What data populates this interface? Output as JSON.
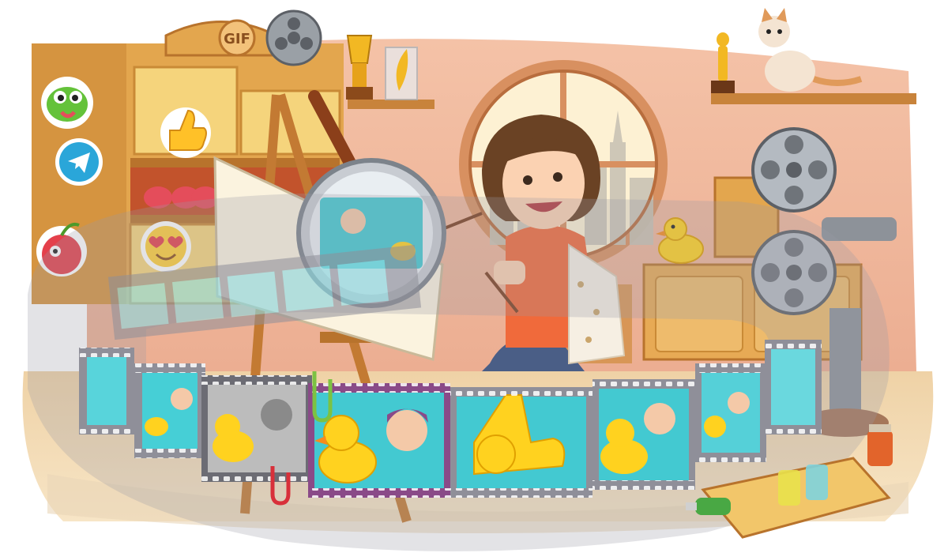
{
  "scene": {
    "cabinet_sign": "GIF",
    "palette": {
      "wall": "#f2b69c",
      "floor": "#e9c79a",
      "wood": "#e3a64e",
      "wood_dark": "#b8732c",
      "window_sky": "#fdf1d3",
      "water": "#3fd2d9",
      "duck": "#ffd21f",
      "film": "#8f8f99",
      "shirt": "#f06a3b",
      "jeans": "#4a5e86"
    },
    "icons": [
      "chameleon-sticker-icon",
      "telegram-logo-icon",
      "cherry-sticker-icon",
      "thumbs-up-sticker-icon",
      "heart-eyes-emoji-icon",
      "magnifying-glass-icon",
      "film-reel-icon",
      "movie-projector-icon",
      "trophy-icon",
      "rubber-duck-icon",
      "cat-icon",
      "paperclip-icon"
    ]
  }
}
